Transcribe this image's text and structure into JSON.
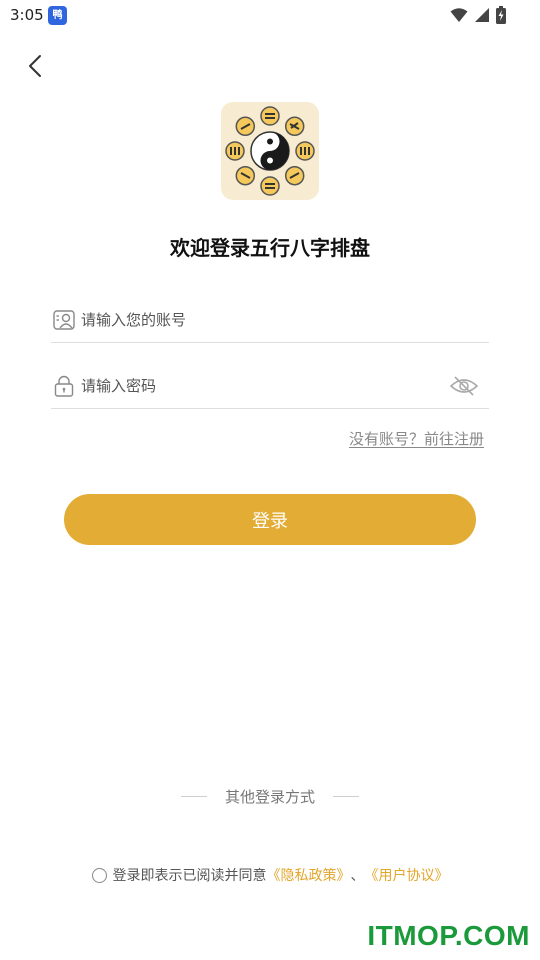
{
  "status_bar": {
    "time": "3:05",
    "app_badge": "鸭"
  },
  "header": {
    "title": "欢迎登录五行八字排盘"
  },
  "form": {
    "account_placeholder": "请输入您的账号",
    "account_value": "",
    "password_placeholder": "请输入密码",
    "password_value": ""
  },
  "register_link": "没有账号？前往注册",
  "login_button": "登录",
  "other_login": "其他登录方式",
  "agreement": {
    "prefix": "登录即表示已阅读并同意",
    "privacy": "《隐私政策》",
    "separator": "、",
    "terms": "《用户协议》"
  },
  "watermark": "ITMOP.COM",
  "colors": {
    "accent": "#e3ad35",
    "link": "#e3a62b",
    "logo_bg": "#f7ecd2"
  }
}
